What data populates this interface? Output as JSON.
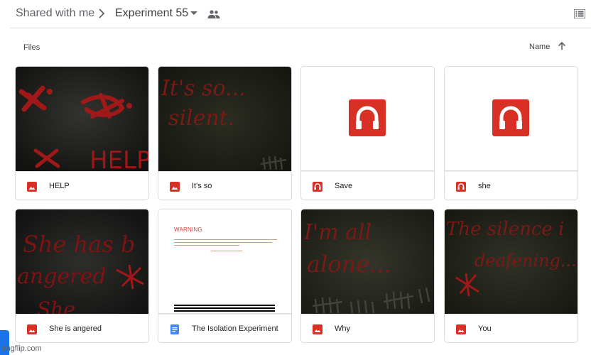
{
  "breadcrumb": {
    "root": "Shared with me",
    "current": "Experiment 55"
  },
  "section": {
    "label": "Files",
    "sort_label": "Name"
  },
  "files": [
    {
      "title": "HELP",
      "type": "image",
      "thumb_text": [
        "HELP"
      ]
    },
    {
      "title": "It's so",
      "type": "image",
      "thumb_text": [
        "It's so...",
        "silent."
      ]
    },
    {
      "title": "Save",
      "type": "app"
    },
    {
      "title": "she",
      "type": "app"
    },
    {
      "title": "She is angered",
      "type": "image",
      "thumb_text": [
        "She has b",
        "angered",
        "She ..."
      ]
    },
    {
      "title": "The Isolation Experiment",
      "type": "doc",
      "thumb_text": [
        "WARNING"
      ]
    },
    {
      "title": "Why",
      "type": "image",
      "thumb_text": [
        "I'm all",
        "alone..."
      ]
    },
    {
      "title": "You",
      "type": "image",
      "thumb_text": [
        "The silence i",
        "deafening..."
      ]
    }
  ],
  "watermark": "imgflip.com",
  "colors": {
    "accent_red": "#d93025",
    "doc_blue": "#4285f4",
    "dark_thumb": "#1e1f1c",
    "scrawl_red": "#a11818"
  },
  "icons": {
    "separator": "chevron-right-icon",
    "dropdown": "caret-down-icon",
    "shared": "people-icon",
    "view": "list-view-icon",
    "sort": "arrow-up-icon",
    "image_type": "image-icon",
    "app_type": "headphones-app-icon",
    "doc_type": "docs-icon"
  }
}
